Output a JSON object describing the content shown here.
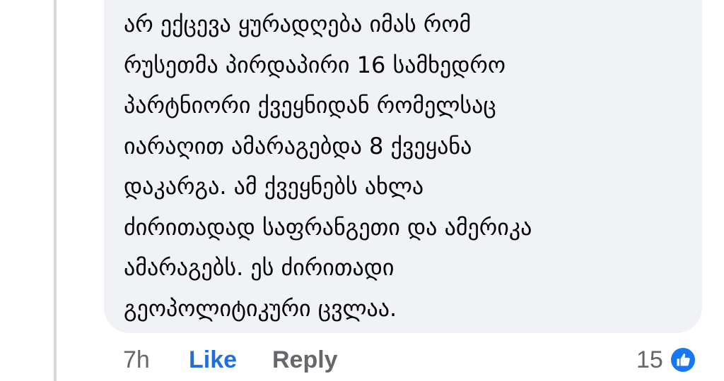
{
  "comment": {
    "lines": [
      "არ ექცევა ყურადღება იმას რომ",
      "რუსეთმა პირდაპირი 16 სამხედრო",
      "პარტნიორი ქვეყნიდან რომელსაც",
      "იარაღით ამარაგებდა 8 ქვეყანა",
      "დაკარგა. ამ ქვეყნებს ახლა",
      "ძირითადად საფრანგეთი და ამერიკა",
      "ამარაგებს. ეს ძირითადი",
      "გეოპოლიტიკური ცვლაა."
    ]
  },
  "actions": {
    "time": "7h",
    "like_label": "Like",
    "reply_label": "Reply"
  },
  "reactions": {
    "count": "15",
    "icon": "thumbs-up-icon",
    "icon_color": "#1877f2"
  },
  "colors": {
    "bubble": "#f0f2f5",
    "text": "#050505",
    "muted": "#65676b",
    "like_accent": "#216fdb",
    "thread_line": "#d6d8dc"
  }
}
